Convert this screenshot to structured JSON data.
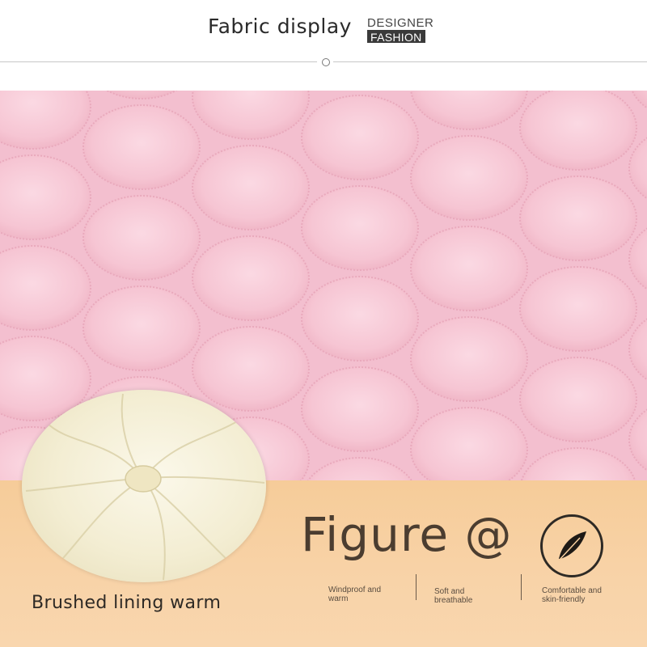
{
  "header": {
    "title": "Fabric display",
    "tag_top": "DESIGNER",
    "tag_bottom": "FASHION"
  },
  "product": {
    "lining_label": "Brushed lining warm",
    "figure_label": "Figure @",
    "feather_icon": "feather-icon"
  },
  "features": [
    {
      "line1": "Windproof and",
      "line2": "warm"
    },
    {
      "line1": "Soft and",
      "line2": "breathable"
    },
    {
      "line1": "Comfortable and",
      "line2": "skin-friendly"
    }
  ],
  "colors": {
    "fabric_pink": "#f6c6d4",
    "panel_peach": "#f7cf9f",
    "lining_cream": "#f3edd2"
  }
}
